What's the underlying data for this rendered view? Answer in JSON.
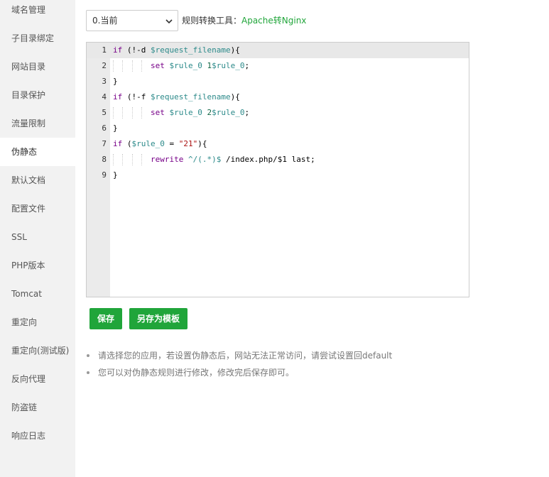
{
  "sidebar": {
    "items": [
      {
        "label": "域名管理",
        "active": false
      },
      {
        "label": "子目录绑定",
        "active": false
      },
      {
        "label": "网站目录",
        "active": false
      },
      {
        "label": "目录保护",
        "active": false
      },
      {
        "label": "流量限制",
        "active": false
      },
      {
        "label": "伪静态",
        "active": true
      },
      {
        "label": "默认文档",
        "active": false
      },
      {
        "label": "配置文件",
        "active": false
      },
      {
        "label": "SSL",
        "active": false
      },
      {
        "label": "PHP版本",
        "active": false
      },
      {
        "label": "Tomcat",
        "active": false
      },
      {
        "label": "重定向",
        "active": false
      },
      {
        "label": "重定向(测试版)",
        "active": false
      },
      {
        "label": "反向代理",
        "active": false
      },
      {
        "label": "防盗链",
        "active": false
      },
      {
        "label": "响应日志",
        "active": false
      }
    ]
  },
  "toolbar": {
    "select_value": "0.当前",
    "tool_label": "规则转换工具：",
    "tool_link": "Apache转Nginx"
  },
  "editor": {
    "active_line": 1,
    "lines": [
      {
        "num": "1",
        "indent": 0,
        "tokens": [
          {
            "t": "if",
            "c": "kw"
          },
          {
            "t": " (!-d ",
            "c": "plain"
          },
          {
            "t": "$request_filename",
            "c": "var2"
          },
          {
            "t": "){",
            "c": "plain"
          }
        ]
      },
      {
        "num": "2",
        "indent": 4,
        "tokens": [
          {
            "t": "set",
            "c": "kw"
          },
          {
            "t": " ",
            "c": "plain"
          },
          {
            "t": "$rule_0",
            "c": "var2"
          },
          {
            "t": " ",
            "c": "plain"
          },
          {
            "t": "1",
            "c": "num"
          },
          {
            "t": "$rule_0",
            "c": "var2"
          },
          {
            "t": ";",
            "c": "plain"
          }
        ]
      },
      {
        "num": "3",
        "indent": 0,
        "tokens": [
          {
            "t": "}",
            "c": "plain"
          }
        ]
      },
      {
        "num": "4",
        "indent": 0,
        "tokens": [
          {
            "t": "if",
            "c": "kw"
          },
          {
            "t": " (!-f ",
            "c": "plain"
          },
          {
            "t": "$request_filename",
            "c": "var2"
          },
          {
            "t": "){",
            "c": "plain"
          }
        ]
      },
      {
        "num": "5",
        "indent": 4,
        "tokens": [
          {
            "t": "set",
            "c": "kw"
          },
          {
            "t": " ",
            "c": "plain"
          },
          {
            "t": "$rule_0",
            "c": "var2"
          },
          {
            "t": " ",
            "c": "plain"
          },
          {
            "t": "2",
            "c": "num"
          },
          {
            "t": "$rule_0",
            "c": "var2"
          },
          {
            "t": ";",
            "c": "plain"
          }
        ]
      },
      {
        "num": "6",
        "indent": 0,
        "tokens": [
          {
            "t": "}",
            "c": "plain"
          }
        ]
      },
      {
        "num": "7",
        "indent": 0,
        "tokens": [
          {
            "t": "if",
            "c": "kw"
          },
          {
            "t": " (",
            "c": "plain"
          },
          {
            "t": "$rule_0",
            "c": "var2"
          },
          {
            "t": " = ",
            "c": "plain"
          },
          {
            "t": "\"21\"",
            "c": "str"
          },
          {
            "t": "){",
            "c": "plain"
          }
        ]
      },
      {
        "num": "8",
        "indent": 4,
        "tokens": [
          {
            "t": "rewrite",
            "c": "kw"
          },
          {
            "t": " ^/(.*)",
            "c": "var2"
          },
          {
            "t": "$",
            "c": "var2"
          },
          {
            "t": " /index.php/$1 last;",
            "c": "plain"
          }
        ]
      },
      {
        "num": "9",
        "indent": 0,
        "tokens": [
          {
            "t": "}",
            "c": "plain"
          }
        ]
      }
    ]
  },
  "buttons": {
    "save": "保存",
    "save_template": "另存为模板"
  },
  "notes": [
    "请选择您的应用，若设置伪静态后，网站无法正常访问，请尝试设置回default",
    "您可以对伪静态规则进行修改，修改完后保存即可。"
  ],
  "colors": {
    "accent": "#20a53a",
    "sidebar_bg": "#f2f2f2"
  }
}
